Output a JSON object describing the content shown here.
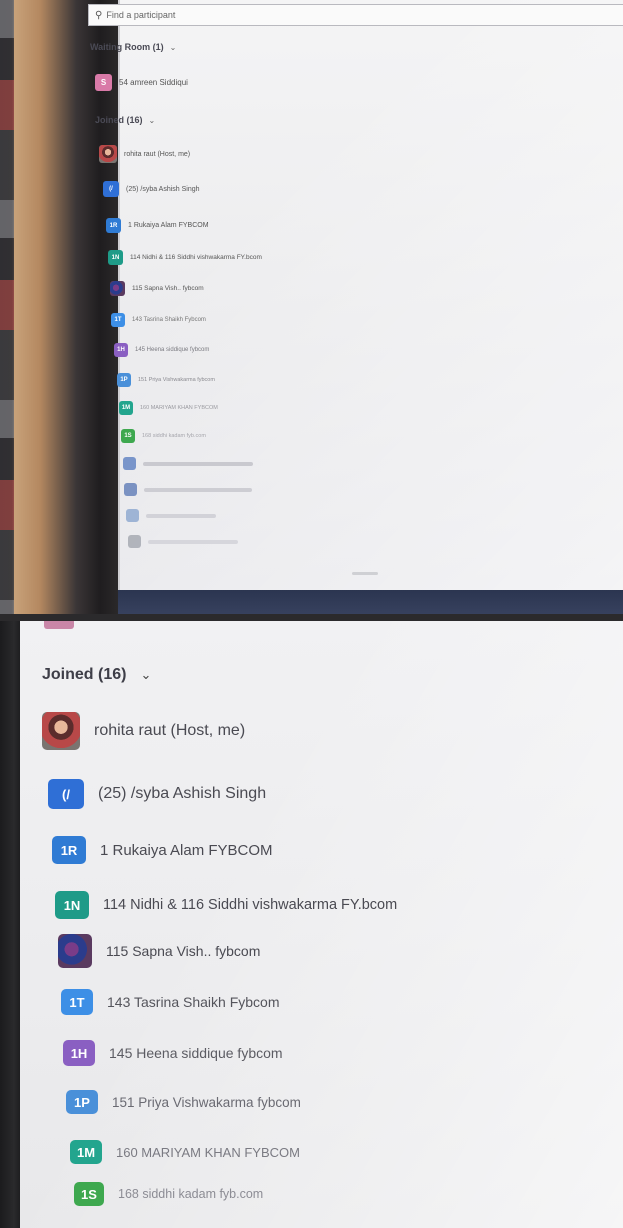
{
  "search": {
    "placeholder": "Find a participant"
  },
  "waiting_room": {
    "label": "Waiting Room (1)",
    "participants": [
      {
        "initials": "S",
        "name": "54 amreen Siddiqui",
        "color": "#d97aa8"
      }
    ]
  },
  "joined": {
    "label": "Joined (16)",
    "participants": [
      {
        "initials": "",
        "name": "rohita raut (Host, me)",
        "color": "#b84848",
        "photo": true
      },
      {
        "initials": "(/",
        "name": "(25) /syba Ashish Singh",
        "color": "#2f6fd6"
      },
      {
        "initials": "1R",
        "name": "1 Rukaiya Alam FYBCOM",
        "color": "#2f7bd4"
      },
      {
        "initials": "1N",
        "name": "114 Nidhi & 116 Siddhi vishwakarma FY.bcom",
        "color": "#1e9b88"
      },
      {
        "initials": "",
        "name": "115 Sapna Vish.. fybcom",
        "color": "#3c4ea0",
        "photo": true
      },
      {
        "initials": "1T",
        "name": "143 Tasrina Shaikh Fybcom",
        "color": "#3d8fe6"
      },
      {
        "initials": "1H",
        "name": "145 Heena siddique fybcom",
        "color": "#8a5fc2"
      },
      {
        "initials": "1P",
        "name": "151 Priya Vishwakarma fybcom",
        "color": "#4a90d9"
      },
      {
        "initials": "1M",
        "name": "160 MARIYAM KHAN FYBCOM",
        "color": "#23a58e"
      },
      {
        "initials": "1S",
        "name": "168 siddhi kadam fyb.com",
        "color": "#3ea84f"
      }
    ]
  },
  "chevron_icon": "chevron-down-icon",
  "search_icon": "search-icon"
}
